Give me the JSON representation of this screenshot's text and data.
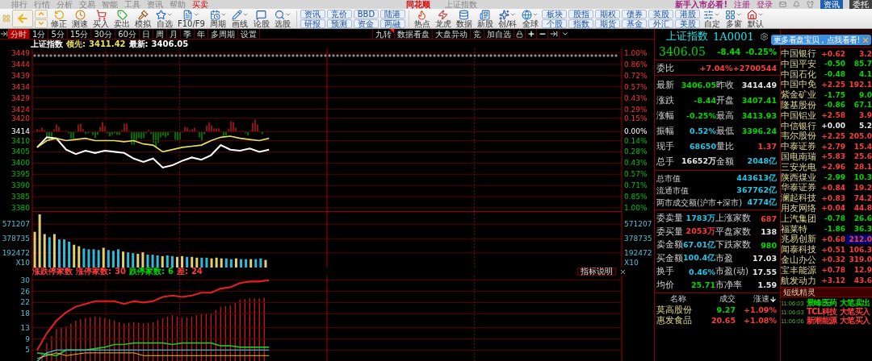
{
  "menu_bar": {
    "items": [
      {
        "label": "排行",
        "selected": false
      },
      {
        "label": "行情",
        "selected": false
      },
      {
        "label": "分析",
        "selected": false
      },
      {
        "label": "交易",
        "selected": false
      },
      {
        "label": "智能",
        "selected": false
      },
      {
        "label": "工具",
        "selected": false
      },
      {
        "label": "资讯",
        "selected": false
      },
      {
        "label": "帮助",
        "selected": false
      },
      {
        "label": "买卖",
        "selected": true
      }
    ],
    "logo": "同花顺",
    "title": "上证指数",
    "notice": "新手入市必看!",
    "links": [
      "注册",
      "登录"
    ],
    "buttons": [
      "资讯",
      "委托"
    ]
  },
  "toolbar": {
    "tools": [
      {
        "label": "修正",
        "dropdown": false
      },
      {
        "label": "测速",
        "dropdown": false
      },
      {
        "label": "买入",
        "dropdown": false
      },
      {
        "label": "卖出",
        "dropdown": false
      },
      {
        "label": "模拟",
        "dropdown": false
      },
      {
        "label": "自选",
        "dropdown": true
      },
      {
        "label": "F10/F9",
        "dropdown": true
      },
      {
        "label": "周期",
        "dropdown": true
      },
      {
        "label": "画线",
        "dropdown": true
      },
      {
        "label": "论股",
        "dropdown": false
      },
      {
        "label": "选股",
        "dropdown": true
      }
    ],
    "info_buttons": [
      [
        "资讯",
        "研报"
      ],
      [
        "竞价",
        "预测"
      ],
      [
        "BBD",
        "资金"
      ],
      [
        "陆港",
        "两融"
      ]
    ],
    "tools2": [
      {
        "label": "热点",
        "dropdown": false
      },
      {
        "label": "龙虎",
        "dropdown": false
      },
      {
        "label": "数据",
        "dropdown": false
      },
      {
        "label": "新股",
        "dropdown": false
      },
      {
        "label": "创/科",
        "dropdown": true
      },
      {
        "label": "全球",
        "dropdown": true
      }
    ],
    "market_buttons": [
      [
        "板块",
        "个股"
      ],
      [
        "股指",
        "指数"
      ],
      [
        "期权",
        "期货"
      ],
      [
        "债券",
        "基金"
      ],
      [
        "英股",
        "外汇"
      ],
      [
        "港股",
        "美股"
      ]
    ],
    "tools3": [
      {
        "label": "自定",
        "dropdown": true
      },
      {
        "label": "多窗",
        "dropdown": true
      },
      {
        "label": "默认",
        "dropdown": true
      }
    ]
  },
  "period_bar": {
    "tabs": [
      {
        "label": "分时",
        "selected": true
      },
      {
        "label": "1分",
        "selected": false
      },
      {
        "label": "5分",
        "selected": false
      },
      {
        "label": "15分",
        "selected": false
      },
      {
        "label": "30分",
        "selected": false
      },
      {
        "label": "60分",
        "selected": false
      },
      {
        "label": "日",
        "selected": false
      },
      {
        "label": "周",
        "selected": false
      },
      {
        "label": "月",
        "selected": false
      },
      {
        "label": "季",
        "selected": false
      },
      {
        "label": "年",
        "selected": false
      },
      {
        "label": "多周期",
        "selected": false
      },
      {
        "label": "设置",
        "selected": false
      }
    ],
    "tools": [
      "九转",
      "数据看盘",
      "大盘异动",
      "竞",
      "加自选"
    ]
  },
  "chart": {
    "price_panel": {
      "title": "上证指数",
      "lead_label": "领先:",
      "lead_value": "3411.42",
      "last_label": "最新:",
      "last_value": "3406.05",
      "percent_labels": [
        "1.00%",
        "0.86%",
        "0.72%",
        "0.57%",
        "0.43%",
        "0.29%",
        "0.15%",
        "0.00%",
        "0.14%",
        "0.28%",
        "0.43%",
        "0.57%",
        "0.71%",
        "0.85%",
        "1.00%"
      ],
      "chart_data": {
        "type": "line",
        "grid": true,
        "categories": [
          null,
          null,
          null,
          null,
          null,
          null,
          null,
          null,
          null,
          null,
          null,
          null,
          null,
          null,
          null,
          null,
          null,
          null,
          null,
          null,
          null,
          null,
          null,
          null,
          null,
          null,
          null,
          null,
          null,
          null,
          null,
          null,
          null,
          null,
          null,
          null,
          null,
          null,
          null,
          null,
          null,
          null,
          null,
          null,
          null,
          null,
          null,
          null,
          null,
          null,
          null,
          null,
          null,
          null,
          null,
          null,
          null,
          null,
          null,
          null,
          null
        ],
        "ylim": [
          3380,
          3449
        ],
        "yticks": [
          3449,
          3444,
          3439,
          3434,
          3429,
          3424,
          3420,
          3414,
          3410,
          3405,
          3400,
          3395,
          3390,
          3385,
          3380
        ],
        "series": [
          {
            "color": "#ffffff",
            "values": [
              3407,
              3411.5,
              3411,
              3406,
              3404,
              3405.5,
              3404.5,
              3405.5,
              3405,
              3404.5,
              3402,
              3400.5,
              3402,
              3398,
              3399,
              3401,
              3402.5,
              3401.5,
              3403.5,
              3408,
              3406,
              3405.5,
              3406.5,
              3405,
              3406,
              null,
              null,
              null,
              null,
              null,
              null,
              null,
              null,
              null,
              null,
              null,
              null,
              null,
              null,
              null,
              null,
              null,
              null,
              null,
              null,
              null,
              null,
              null,
              null,
              null,
              null,
              null,
              null,
              null,
              null,
              null,
              null,
              null,
              null,
              null,
              null
            ]
          },
          {
            "color": "#e8e060",
            "values": [
              3407,
              3410,
              3411,
              3410,
              3410.5,
              3411,
              3410,
              3410,
              3410,
              3409.5,
              3410,
              3408.5,
              3408,
              3405,
              3406,
              3407,
              3407.5,
              3408,
              3410,
              3411.5,
              3412,
              3411,
              3410.5,
              3410,
              3411,
              null,
              null,
              null,
              null,
              null,
              null,
              null,
              null,
              null,
              null,
              null,
              null,
              null,
              null,
              null,
              null,
              null,
              null,
              null,
              null,
              null,
              null,
              null,
              null,
              null,
              null,
              null,
              null,
              null,
              null,
              null,
              null,
              null,
              null,
              null,
              null
            ]
          }
        ]
      }
    },
    "volume_panel": {
      "right_labels": [
        "571207",
        "378735",
        "192472"
      ],
      "unit_left": "X10",
      "unit_right": "X10",
      "chart_data": {
        "type": "bar",
        "grid": true,
        "categories": [
          null,
          null,
          null,
          null,
          null,
          null,
          null,
          null,
          null,
          null,
          null,
          null,
          null,
          null,
          null,
          null,
          null,
          null,
          null,
          null,
          null,
          null,
          null,
          null,
          null,
          null,
          null,
          null,
          null,
          null,
          null,
          null,
          null,
          null,
          null,
          null,
          null,
          null,
          null,
          null,
          null,
          null,
          null,
          null,
          null,
          null,
          null,
          null,
          null,
          null,
          null,
          null,
          null,
          null,
          null,
          null,
          null,
          null,
          null,
          null,
          null,
          null,
          null,
          null,
          null,
          null,
          null,
          null,
          null,
          null,
          null,
          null,
          null,
          null,
          null,
          null,
          null,
          null,
          null,
          null,
          null,
          null,
          null,
          null,
          null,
          null,
          null,
          null,
          null,
          null,
          null,
          null,
          null,
          null,
          null,
          null,
          null,
          null,
          null,
          null,
          null,
          null,
          null,
          null,
          null,
          null,
          null,
          null,
          null,
          null,
          null,
          null,
          null,
          null,
          null,
          null,
          null,
          null,
          null,
          null
        ],
        "ylim": [
          0,
          700000
        ],
        "yticks": [
          571207,
          378735,
          192472
        ],
        "series": [
          {
            "color": "#e0d070",
            "values": [
              470000,
              700000,
              440000,
              null,
              440000,
              null,
              null,
              null,
              300000,
              280000,
              null,
              null,
              null,
              null,
              260000,
              null,
              null,
              null,
              210000,
              null,
              null,
              180000,
              200000,
              null,
              null,
              null,
              150000,
              null,
              null,
              140000,
              150000,
              null,
              140000,
              130000,
              null,
              null,
              120000,
              130000,
              120000,
              null,
              null,
              120000,
              null,
              null,
              110000,
              null,
              null,
              100000,
              null,
              null,
              null,
              null,
              null,
              null,
              null,
              null,
              null,
              null,
              null,
              null,
              null,
              null,
              null,
              null,
              null,
              null,
              null,
              null,
              null,
              null,
              null,
              null,
              null,
              null,
              null,
              null,
              null,
              null,
              null,
              null,
              null,
              null,
              null,
              null,
              null,
              null,
              null,
              null,
              null,
              null,
              null,
              null,
              null,
              null,
              null,
              null,
              null,
              null,
              null,
              null,
              null,
              null,
              null,
              null,
              null,
              null,
              null,
              null,
              null,
              null,
              null,
              null,
              null,
              null,
              null,
              null,
              null,
              null,
              null,
              null
            ]
          },
          {
            "color": "#30b8d8",
            "values": [
              null,
              null,
              null,
              400000,
              null,
              370000,
              370000,
              340000,
              null,
              null,
              250000,
              240000,
              240000,
              230000,
              null,
              230000,
              220000,
              240000,
              null,
              200000,
              190000,
              null,
              null,
              170000,
              170000,
              160000,
              null,
              160000,
              150000,
              null,
              null,
              140000,
              null,
              null,
              130000,
              130000,
              null,
              null,
              null,
              120000,
              110000,
              null,
              110000,
              110000,
              null,
              110000,
              120000,
              null,
              null,
              null,
              null,
              null,
              null,
              null,
              null,
              null,
              null,
              null,
              null,
              null,
              null,
              null,
              null,
              null,
              null,
              null,
              null,
              null,
              null,
              null,
              null,
              null,
              null,
              null,
              null,
              null,
              null,
              null,
              null,
              null,
              null,
              null,
              null,
              null,
              null,
              null,
              null,
              null,
              null,
              null,
              null,
              null,
              null,
              null,
              null,
              null,
              null,
              null,
              null,
              null,
              null,
              null,
              null,
              null,
              null,
              null,
              null,
              null,
              null,
              null,
              null,
              null,
              null,
              null,
              null,
              null,
              null,
              null,
              null,
              null
            ]
          }
        ]
      }
    },
    "breadth_panel": {
      "title": "涨跌停家数",
      "stats": [
        {
          "label": "涨停家数:",
          "value": "30",
          "color": "#ff3c3c"
        },
        {
          "label": "跌停家数:",
          "value": "6",
          "color": "#00d800"
        },
        {
          "label": "差:",
          "value": "24",
          "color": "#ff3c3c"
        }
      ],
      "help": "指标说明",
      "chart_data": {
        "type": "line",
        "grid": true,
        "categories": [
          null,
          null,
          null,
          null,
          null,
          null,
          null,
          null,
          null,
          null,
          null,
          null,
          null,
          null,
          null,
          null,
          null,
          null,
          null,
          null,
          null,
          null,
          null,
          null,
          null,
          null,
          null,
          null,
          null,
          null,
          null,
          null,
          null,
          null,
          null,
          null,
          null,
          null,
          null,
          null,
          null,
          null,
          null,
          null,
          null,
          null,
          null,
          null,
          null,
          null,
          null,
          null,
          null,
          null,
          null,
          null,
          null,
          null,
          null,
          null,
          null
        ],
        "ylim": [
          0.5,
          30.2
        ],
        "yticks": [
          30,
          26,
          22,
          18,
          13,
          9,
          5
        ],
        "series": [
          {
            "color": "#e02020",
            "values": [
              5,
              11,
              15.5,
              18.5,
              20.5,
              21.5,
              22.5,
              22.5,
              22.5,
              21.5,
              22.5,
              22,
              22.5,
              24,
              24.5,
              24,
              24.5,
              25.5,
              25.5,
              27,
              27.5,
              29,
              29.5,
              29.5,
              30,
              null,
              null,
              null,
              null,
              null,
              null,
              null,
              null,
              null,
              null,
              null,
              null,
              null,
              null,
              null,
              null,
              null,
              null,
              null,
              null,
              null,
              null,
              null,
              null,
              null,
              null,
              null,
              null,
              null,
              null,
              null,
              null,
              null,
              null,
              null,
              null
            ]
          },
          {
            "color": "#20c020",
            "values": [
              4,
              3.5,
              3,
              5,
              5,
              5,
              5.5,
              6,
              7,
              7,
              7.5,
              7.5,
              7.5,
              7.5,
              7,
              7.5,
              7.5,
              7.5,
              7.5,
              6.5,
              6.5,
              6,
              6,
              6,
              6,
              null,
              null,
              null,
              null,
              null,
              null,
              null,
              null,
              null,
              null,
              null,
              null,
              null,
              null,
              null,
              null,
              null,
              null,
              null,
              null,
              null,
              null,
              null,
              null,
              null,
              null,
              null,
              null,
              null,
              null,
              null,
              null,
              null,
              null,
              null,
              null
            ]
          },
          {
            "color": "#30c0e0",
            "values": [
              1,
              4,
              5,
              5,
              5,
              5,
              5,
              5,
              5,
              5,
              5,
              5,
              5,
              5,
              5,
              5,
              5,
              5,
              5,
              5,
              5,
              5,
              5,
              5,
              5,
              null,
              null,
              null,
              null,
              null,
              null,
              null,
              null,
              null,
              null,
              null,
              null,
              null,
              null,
              null,
              null,
              null,
              null,
              null,
              null,
              null,
              null,
              null,
              null,
              null,
              null,
              null,
              null,
              null,
              null,
              null,
              null,
              null,
              null,
              null,
              null
            ]
          },
          {
            "color": "#e0c020",
            "values": [
              2,
              3,
              4,
              3,
              3.5,
              4,
              4,
              4,
              4,
              4,
              4,
              3,
              3,
              3,
              3,
              3,
              3,
              3,
              3,
              3,
              3,
              3,
              3,
              3,
              3,
              null,
              null,
              null,
              null,
              null,
              null,
              null,
              null,
              null,
              null,
              null,
              null,
              null,
              null,
              null,
              null,
              null,
              null,
              null,
              null,
              null,
              null,
              null,
              null,
              null,
              null,
              null,
              null,
              null,
              null,
              null,
              null,
              null,
              null,
              null,
              null
            ]
          }
        ]
      }
    }
  },
  "quote": {
    "title": "上证指数",
    "code": "1A0001",
    "price": "3406.05",
    "change": "-8.44",
    "change_pct": "-0.25%",
    "color": "#00d800",
    "order_ratio": {
      "label": "委比",
      "value": "+7.04%",
      "diff": "+2700544",
      "color": "#ff3c3c"
    },
    "grid": [
      [
        {
          "label": "最新",
          "value": "3406.05",
          "color": "#00d800"
        },
        {
          "label": "昨收",
          "value": "3414.49",
          "color": "#e8e8e8"
        }
      ],
      [
        {
          "label": "涨跌",
          "value": "-8.44",
          "color": "#00d800"
        },
        {
          "label": "开盘",
          "value": "3407.41",
          "color": "#00d800"
        }
      ],
      [
        {
          "label": "涨幅",
          "value": "-0.25%",
          "color": "#00d800"
        },
        {
          "label": "最高",
          "value": "3413.93",
          "color": "#00d800"
        }
      ],
      [
        {
          "label": "振幅",
          "value": "0.52%",
          "color": "#20c8e8"
        },
        {
          "label": "最低",
          "value": "3396.24",
          "color": "#00d800"
        }
      ],
      [
        {
          "label": "现手",
          "value": "68650",
          "color": "#20c8e8"
        },
        {
          "label": "量比",
          "value": "1.37",
          "color": "#ff3c3c"
        }
      ],
      [
        {
          "label": "总手",
          "value": "16652万",
          "color": "#e8e8e8"
        },
        {
          "label": "金额",
          "value": "2048亿",
          "color": "#20c8e8"
        }
      ]
    ],
    "market": [
      {
        "label": "总市值",
        "value": "443613亿",
        "color": "#20c8e8"
      },
      {
        "label": "流通市值",
        "value": "367762亿",
        "color": "#20c8e8"
      },
      {
        "label": "两市成交额(沪市+深市)",
        "value": "4774亿",
        "color": "#20c8e8"
      }
    ],
    "breadth": [
      [
        {
          "label": "委卖量",
          "value": "1783万",
          "color": "#20c8e8"
        },
        {
          "label": "上涨家数",
          "value": "687",
          "color": "#ff3c3c"
        }
      ],
      [
        {
          "label": "委买量",
          "value": "2053万",
          "color": "#ff3c3c"
        },
        {
          "label": "平盘家数",
          "value": "138",
          "color": "#e8e8e8"
        }
      ],
      [
        {
          "label": "卖金额",
          "value": "67.01亿",
          "color": "#20c8e8"
        },
        {
          "label": "下跌家数",
          "value": "980",
          "color": "#00d800"
        }
      ],
      [
        {
          "label": "买金额",
          "value": "100.4亿",
          "color": "#20c8e8"
        },
        {
          "label": "市盈",
          "value": "17.03",
          "color": "#e8e8e8"
        }
      ],
      [
        {
          "label": "换手",
          "value": "0.46%",
          "color": "#20c8e8"
        },
        {
          "label": "市盈(动)",
          "value": "17.55",
          "color": "#e8e8e8"
        }
      ],
      [
        {
          "label": "均价",
          "value": "25.71",
          "color": "#00d800"
        },
        {
          "label": "市净率",
          "value": "1.59",
          "color": "#e8e8e8"
        }
      ]
    ],
    "movers": {
      "columns": [
        "名称",
        "成交",
        "涨速"
      ],
      "rows": [
        {
          "cells": [
            {
              "text": "莫高股份"
            },
            {
              "text": "9.27",
              "color": "#00d800"
            },
            {
              "text": "+1.09%",
              "color": "#ff3c3c"
            }
          ]
        },
        {
          "cells": [
            {
              "text": "惠发食品"
            },
            {
              "text": "20.65",
              "color": "#ff3c3c"
            },
            {
              "text": "+1.08%",
              "color": "#ff3c3c"
            }
          ]
        }
      ]
    }
  },
  "tooltip": {
    "text": "更多看盘宝贝，点我看看!"
  },
  "watchlist": [
    {
      "name": "中国银行",
      "change": "+0.62",
      "price": "3.2",
      "color": "#ff3c3c",
      "selected": false
    },
    {
      "name": "中国平安",
      "change": "-0.50",
      "price": "85.7",
      "color": "#00d800",
      "selected": false
    },
    {
      "name": "中国石化",
      "change": "-0.48",
      "price": "4.1",
      "color": "#00d800",
      "selected": false
    },
    {
      "name": "中国中免",
      "change": "+2.25",
      "price": "192.1",
      "color": "#ff3c3c",
      "selected": false
    },
    {
      "name": "紫金矿业",
      "change": "-1.75",
      "price": "9.0",
      "color": "#00d800",
      "selected": false
    },
    {
      "name": "隆基股份",
      "change": "-0.86",
      "price": "67.1",
      "color": "#00d800",
      "selected": false
    },
    {
      "name": "中国铝业",
      "change": "+2.58",
      "price": "3.9",
      "color": "#ff3c3c",
      "selected": false
    },
    {
      "name": "中信银行",
      "change": "+0.00",
      "price": "5.2",
      "color": "#e8e8e8",
      "selected": false
    },
    {
      "name": "韦尔股份",
      "change": "+2.25",
      "price": "205.0",
      "color": "#ff3c3c",
      "selected": false
    },
    {
      "name": "中泰证券",
      "change": "+2.79",
      "price": "15.4",
      "color": "#ff3c3c",
      "selected": false
    },
    {
      "name": "国电南瑞",
      "change": "+5.83",
      "price": "25.6",
      "color": "#ff3c3c",
      "selected": false
    },
    {
      "name": "三安光电",
      "change": "+2.96",
      "price": "28.1",
      "color": "#ff3c3c",
      "selected": false
    },
    {
      "name": "陕西煤业",
      "change": "-2.99",
      "price": "10.3",
      "color": "#00d800",
      "selected": false
    },
    {
      "name": "华泰证券",
      "change": "+0.84",
      "price": "19.2",
      "color": "#ff3c3c",
      "selected": false
    },
    {
      "name": "澜起科技",
      "change": "+0.83",
      "price": "74.2",
      "color": "#ff3c3c",
      "selected": false
    },
    {
      "name": "用友网络",
      "change": "+0.04",
      "price": "44.8",
      "color": "#ff3c3c",
      "selected": false
    },
    {
      "name": "上汽集团",
      "change": "-0.78",
      "price": "26.6",
      "color": "#00d800",
      "selected": false
    },
    {
      "name": "福莱特",
      "change": "-1.86",
      "price": "36.3",
      "color": "#00d800",
      "selected": false
    },
    {
      "name": "兆易创新",
      "change": "+0.68",
      "price": "212.0",
      "color": "#ff3c3c",
      "selected": true
    },
    {
      "name": "闻泰科技",
      "change": "+0.51",
      "price": "106.3",
      "color": "#ff3c3c",
      "selected": false
    },
    {
      "name": "金山办公",
      "change": "+0.32",
      "price": "319.0",
      "color": "#ff3c3c",
      "selected": false
    },
    {
      "name": "宝丰能源",
      "change": "+0.78",
      "price": "12.9",
      "color": "#ff3c3c",
      "selected": false
    },
    {
      "name": "航发动力",
      "change": "+3.12",
      "price": "43.6",
      "color": "#ff3c3c",
      "selected": false
    }
  ],
  "alerts": {
    "title": "短线精灵",
    "rows": [
      {
        "time": "11:06:03",
        "name": "景峰医药",
        "action": "大笔卖出",
        "color": "#00d800"
      },
      {
        "time": "11:06:03",
        "name": "TCL科技",
        "action": "大笔买入",
        "color": "#ff3c3c"
      },
      {
        "time": "11:06:06",
        "name": "新潮能源",
        "action": "大笔买入",
        "color": "#ff3c3c"
      }
    ]
  }
}
